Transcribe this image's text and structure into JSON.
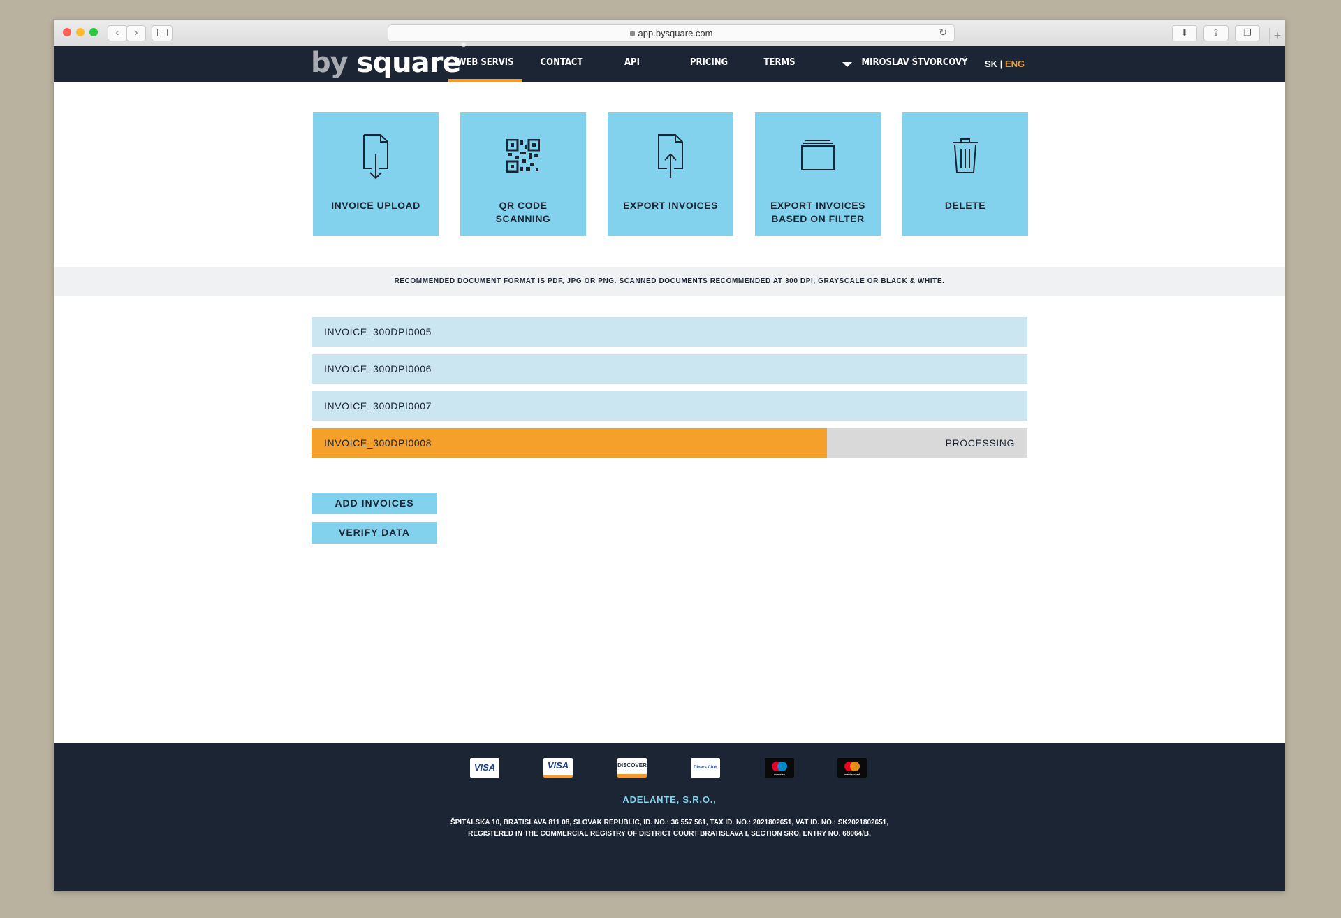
{
  "browser": {
    "url": "app.bysquare.com",
    "back_icon": "chevron-left-icon",
    "forward_icon": "chevron-right-icon",
    "sidebar_icon": "sidebar-icon",
    "reload_icon": "reload-icon",
    "download_icon": "download-icon",
    "share_icon": "share-icon",
    "tabs_icon": "tabs-icon"
  },
  "header": {
    "logo_by": "by",
    "logo_square": "square",
    "logo_reg": "®",
    "nav": [
      "WEB SERVIS",
      "CONTACT",
      "API",
      "PRICING",
      "TERMS"
    ],
    "active_nav": "WEB SERVIS",
    "user": "MIROSLAV ŠTVORCOVÝ",
    "lang_sk": "SK",
    "lang_sep": "|",
    "lang_eng": "ENG",
    "accent": "#f29b2a"
  },
  "tiles": [
    {
      "label": "INVOICE UPLOAD",
      "icon": "document-download-icon"
    },
    {
      "label": "QR CODE\nSCANNING",
      "icon": "qr-code-icon"
    },
    {
      "label": "EXPORT INVOICES",
      "icon": "document-upload-icon"
    },
    {
      "label": "EXPORT INVOICES\nBASED ON FILTER",
      "icon": "folder-icon"
    },
    {
      "label": "DELETE",
      "icon": "trash-icon"
    }
  ],
  "notice": "RECOMMENDED DOCUMENT FORMAT IS PDF, JPG OR PNG. SCANNED DOCUMENTS RECOMMENDED AT 300 DPI, GRAYSCALE OR BLACK & WHITE.",
  "files": [
    {
      "name": "INVOICE_300DPI0005"
    },
    {
      "name": "INVOICE_300DPI0006"
    },
    {
      "name": "INVOICE_300DPI0007"
    },
    {
      "name": "INVOICE_300DPI0008",
      "status": "PROCESSING",
      "progress": 0.72
    }
  ],
  "buttons": {
    "add": "ADD INVOICES",
    "verify": "VERIFY DATA"
  },
  "footer": {
    "cards": [
      "VISA",
      "VISA",
      "DISCOVER",
      "Diners Club",
      "maestro",
      "mastercard"
    ],
    "company": "ADELANTE, S.R.O.,",
    "address_line1": "ŠPITÁLSKA 10, BRATISLAVA 811 08, SLOVAK REPUBLIC, ID. NO.: 36 557 561, TAX ID. NO.: 2021802651, VAT ID. NO.: SK2021802651,",
    "address_line2": "REGISTERED IN THE COMMERCIAL REGISTRY OF DISTRICT COURT BRATISLAVA I, SECTION SRO, ENTRY NO. 68064/B."
  },
  "colors": {
    "navy": "#1b2533",
    "tile_blue": "#82d2ee",
    "row_blue": "#cce6f1",
    "progress_orange": "#f5a02a"
  }
}
